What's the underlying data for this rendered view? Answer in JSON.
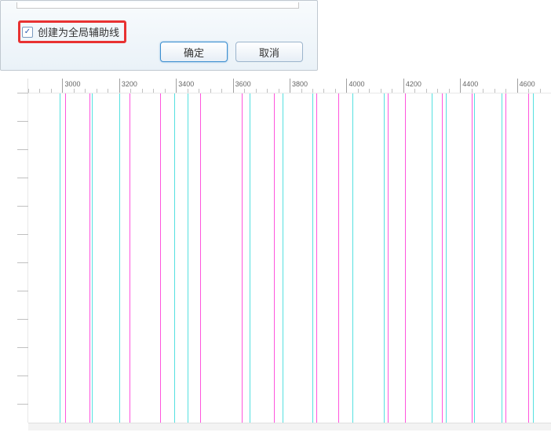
{
  "dialog": {
    "checkbox": {
      "checked": true,
      "label": "创建为全局辅助线"
    },
    "buttons": {
      "ok": "确定",
      "cancel": "取消"
    }
  },
  "ruler": {
    "start": 2880,
    "end": 4700,
    "majorStep": 200,
    "minorStep": 40,
    "pxPerUnit": 0.362,
    "labels": [
      3000,
      3200,
      3400,
      3600,
      3800,
      4000,
      4200,
      4400,
      4600
    ]
  },
  "guides": [
    {
      "pos": 2990,
      "color": "cyan"
    },
    {
      "pos": 3010,
      "color": "magenta"
    },
    {
      "pos": 3095,
      "color": "magenta"
    },
    {
      "pos": 3105,
      "color": "cyan"
    },
    {
      "pos": 3200,
      "color": "cyan"
    },
    {
      "pos": 3235,
      "color": "magenta"
    },
    {
      "pos": 3345,
      "color": "magenta"
    },
    {
      "pos": 3395,
      "color": "cyan"
    },
    {
      "pos": 3440,
      "color": "cyan"
    },
    {
      "pos": 3485,
      "color": "magenta"
    },
    {
      "pos": 3630,
      "color": "magenta"
    },
    {
      "pos": 3660,
      "color": "cyan"
    },
    {
      "pos": 3745,
      "color": "magenta"
    },
    {
      "pos": 3775,
      "color": "cyan"
    },
    {
      "pos": 3880,
      "color": "cyan"
    },
    {
      "pos": 3895,
      "color": "magenta"
    },
    {
      "pos": 3970,
      "color": "magenta"
    },
    {
      "pos": 4020,
      "color": "cyan"
    },
    {
      "pos": 4130,
      "color": "cyan"
    },
    {
      "pos": 4145,
      "color": "magenta"
    },
    {
      "pos": 4205,
      "color": "magenta"
    },
    {
      "pos": 4300,
      "color": "cyan"
    },
    {
      "pos": 4335,
      "color": "magenta"
    },
    {
      "pos": 4350,
      "color": "cyan"
    },
    {
      "pos": 4440,
      "color": "magenta"
    },
    {
      "pos": 4450,
      "color": "cyan"
    },
    {
      "pos": 4545,
      "color": "cyan"
    },
    {
      "pos": 4560,
      "color": "magenta"
    },
    {
      "pos": 4640,
      "color": "magenta"
    },
    {
      "pos": 4655,
      "color": "cyan"
    }
  ]
}
